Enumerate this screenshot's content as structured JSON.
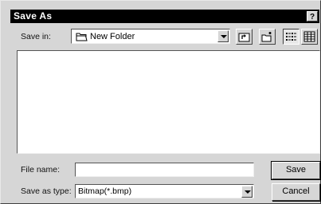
{
  "window": {
    "title": "Save As",
    "help_label": "?"
  },
  "toolbar": {
    "save_in_label": "Save in:",
    "save_in_value": "New Folder",
    "buttons": [
      {
        "name": "up-one-level-icon"
      },
      {
        "name": "create-new-folder-icon"
      },
      {
        "name": "list-view-icon",
        "pressed": true
      },
      {
        "name": "details-view-icon"
      }
    ]
  },
  "file_list": {
    "items": []
  },
  "form": {
    "file_name_label": "File name:",
    "file_name_value": "",
    "save_as_type_label": "Save as type:",
    "save_as_type_value": "Bitmap(*.bmp)"
  },
  "buttons": {
    "save_label": "Save",
    "cancel_label": "Cancel"
  }
}
